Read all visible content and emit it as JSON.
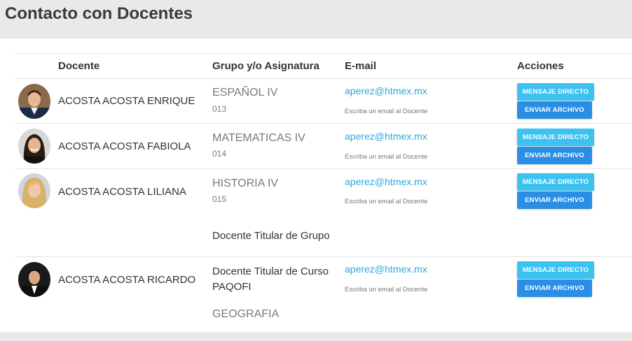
{
  "page": {
    "title": "Contacto con Docentes"
  },
  "table": {
    "headers": {
      "docente": "Docente",
      "grupo": "Grupo y/o Asignatura",
      "email": "E-mail",
      "acciones": "Acciones"
    }
  },
  "rows": [
    {
      "name": "ACOSTA ACOSTA ENRIQUE",
      "subject": "ESPAÑOL IV",
      "group": "013",
      "email": "aperez@htmex.mx",
      "email_hint": "Escriba un email al Docente",
      "btn_message": "MENSAJE DIRECTO",
      "btn_file": "ENVIAR ARCHIVO"
    },
    {
      "name": "ACOSTA ACOSTA FABIOLA",
      "subject": "MATEMATICAS IV",
      "group": "014",
      "email": "aperez@htmex.mx",
      "email_hint": "Escriba un email al Docente",
      "btn_message": "MENSAJE DIRECTO",
      "btn_file": "ENVIAR ARCHIVO"
    },
    {
      "name": "ACOSTA ACOSTA LILIANA",
      "subject": "HISTORIA IV",
      "group": "015",
      "extra": "Docente Titular de Grupo",
      "email": "aperez@htmex.mx",
      "email_hint": "Escriba un email al Docente",
      "btn_message": "MENSAJE DIRECTO",
      "btn_file": "ENVIAR ARCHIVO"
    },
    {
      "name": "ACOSTA ACOSTA RICARDO",
      "role_line1": "Docente Titular de Curso",
      "role_line2": "PAQOFI",
      "next_subject": "GEOGRAFIA",
      "email": "aperez@htmex.mx",
      "email_hint": "Escriba un email al Docente",
      "btn_message": "MENSAJE DIRECTO",
      "btn_file": "ENVIAR ARCHIVO"
    }
  ]
}
